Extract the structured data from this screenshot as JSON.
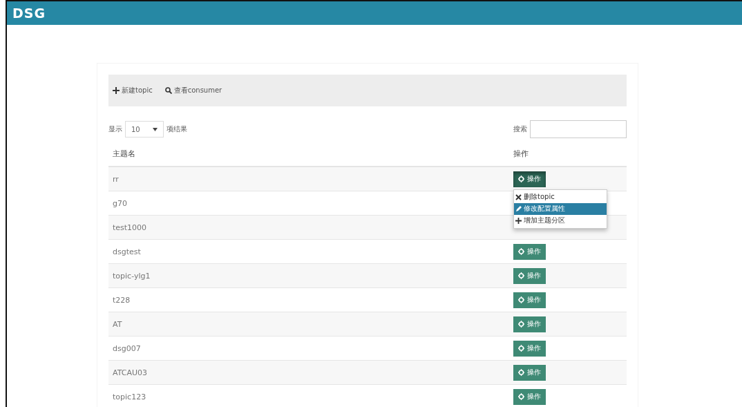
{
  "header": {
    "logo": "DSG"
  },
  "toolbar": [
    {
      "kind": "plus",
      "label": "新建topic"
    },
    {
      "kind": "search",
      "label": "查看consumer"
    }
  ],
  "length_control": {
    "prefix": "显示",
    "value": "10",
    "suffix": "项结果"
  },
  "search": {
    "label": "搜索"
  },
  "table": {
    "columns": [
      "主题名",
      "操作"
    ],
    "rows": [
      {
        "name": "rr",
        "action": "操作",
        "menu_open": true
      },
      {
        "name": "g70"
      },
      {
        "name": "test1000"
      },
      {
        "name": "dsgtest",
        "action": "操作",
        "menu_open": false
      },
      {
        "name": "topic-ylg1",
        "action": "操作",
        "menu_open": false
      },
      {
        "name": "t228",
        "action": "操作",
        "menu_open": false
      },
      {
        "name": "AT",
        "action": "操作",
        "menu_open": false
      },
      {
        "name": "dsg007",
        "action": "操作",
        "menu_open": false
      },
      {
        "name": "ATCAU03",
        "action": "操作",
        "menu_open": false
      },
      {
        "name": "topic123",
        "action": "操作",
        "menu_open": false
      }
    ]
  },
  "menu": {
    "items": [
      {
        "kind": "delete",
        "label": "删除topic",
        "selected": false
      },
      {
        "kind": "edit",
        "label": "修改配置属性",
        "selected": true
      },
      {
        "kind": "plus",
        "label": "增加主题分区",
        "selected": false
      }
    ]
  }
}
